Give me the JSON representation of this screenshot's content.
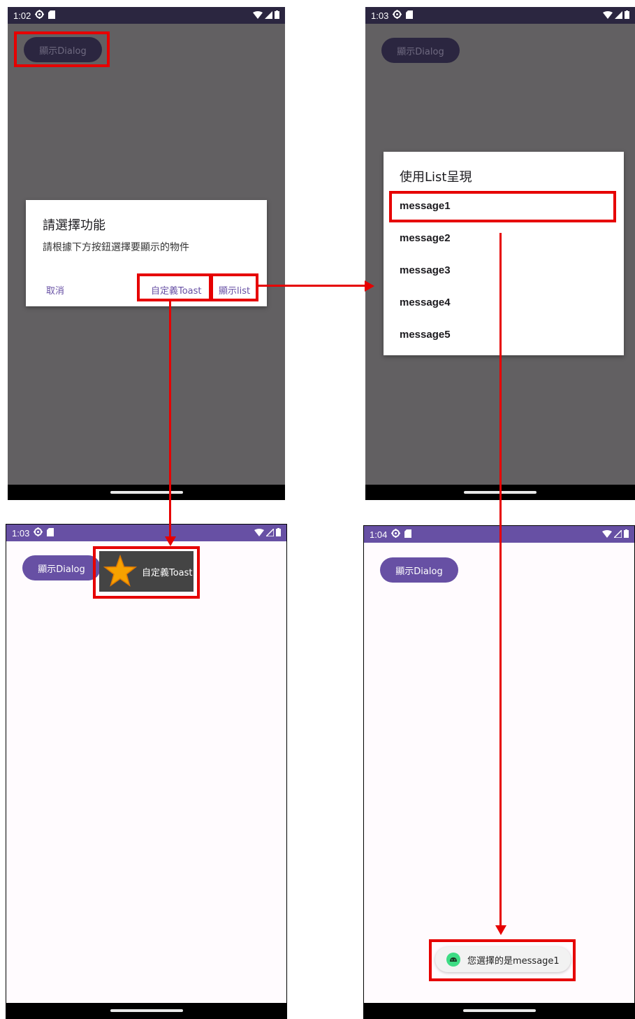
{
  "colors": {
    "primary": "#6750a4",
    "status_bar_dark": "#2b2640",
    "scrim": "#626062",
    "highlight_red": "#e60000",
    "background": "#fffbfe"
  },
  "screens": [
    {
      "time": "1:02",
      "button_label": "顯示Dialog"
    },
    {
      "time": "1:03",
      "button_label": "顯示Dialog"
    },
    {
      "time": "1:03",
      "button_label": "顯示Dialog"
    },
    {
      "time": "1:04",
      "button_label": "顯示Dialog"
    }
  ],
  "status_icons": [
    "settings-icon",
    "sim-card-icon",
    "wifi-icon",
    "signal-icon",
    "battery-icon"
  ],
  "alert_dialog": {
    "title": "請選擇功能",
    "message": "請根據下方按鈕選擇要顯示的物件",
    "cancel_label": "取消",
    "toast_label": "自定義Toast",
    "list_label": "顯示list"
  },
  "list_dialog": {
    "title": "使用List呈現",
    "items": [
      "message1",
      "message2",
      "message3",
      "message4",
      "message5"
    ]
  },
  "custom_toast": {
    "text": "自定義Toast",
    "icon": "star-icon"
  },
  "system_toast": {
    "text": "您選擇的是message1",
    "icon": "android-icon"
  }
}
